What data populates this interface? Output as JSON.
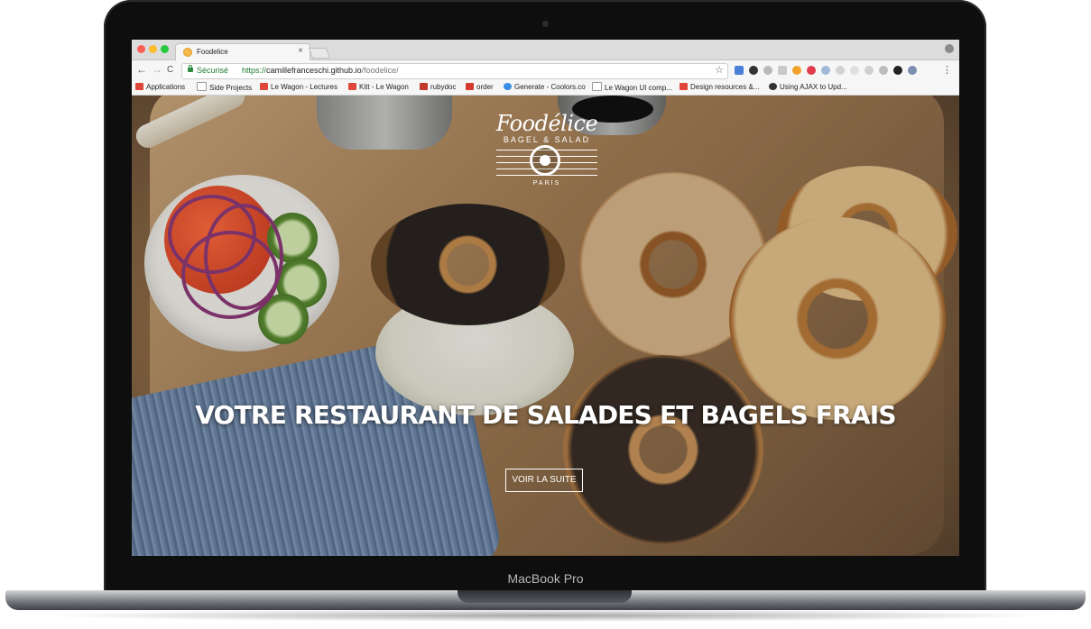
{
  "device": {
    "label": "MacBook Pro"
  },
  "browser": {
    "tab": {
      "title": "Foodelice",
      "close": "×"
    },
    "nav": {
      "back": "←",
      "forward": "→",
      "reload": "C"
    },
    "address": {
      "security_label": "Sécurisé",
      "url_scheme": "https://",
      "url_host": "camillefranceschi.github.io",
      "url_path": "/foodelice/"
    },
    "bookmarks": [
      {
        "label": "Applications",
        "icon": "apps-grid-icon",
        "color": "#e0453a"
      },
      {
        "label": "Side Projects",
        "icon": "page-icon",
        "color": "#9a9a9a"
      },
      {
        "label": "Le Wagon - Lectures",
        "icon": "le-wagon-icon",
        "color": "#e0453a"
      },
      {
        "label": "Kitt - Le Wagon",
        "icon": "kitt-icon",
        "color": "#e0453a"
      },
      {
        "label": "rubydoc",
        "icon": "ruby-icon",
        "color": "#c0392b"
      },
      {
        "label": "order",
        "icon": "brush-icon",
        "color": "#d63a2f"
      },
      {
        "label": "Generate - Coolors.co",
        "icon": "coolors-icon",
        "color": "#3a8ee6"
      },
      {
        "label": "Le Wagon UI comp...",
        "icon": "page-icon",
        "color": "#9a9a9a"
      },
      {
        "label": "Design resources &...",
        "icon": "design-icon",
        "color": "#e0453a"
      },
      {
        "label": "Using AJAX to Upd...",
        "icon": "github-icon",
        "color": "#333333"
      }
    ]
  },
  "page": {
    "logo": {
      "name": "Foodélice",
      "tagline": "BAGEL & SALAD",
      "city": "PARIS"
    },
    "headline": "VOTRE RESTAURANT DE SALADES ET BAGELS FRAIS",
    "cta_label": "VOIR LA SUITE"
  }
}
